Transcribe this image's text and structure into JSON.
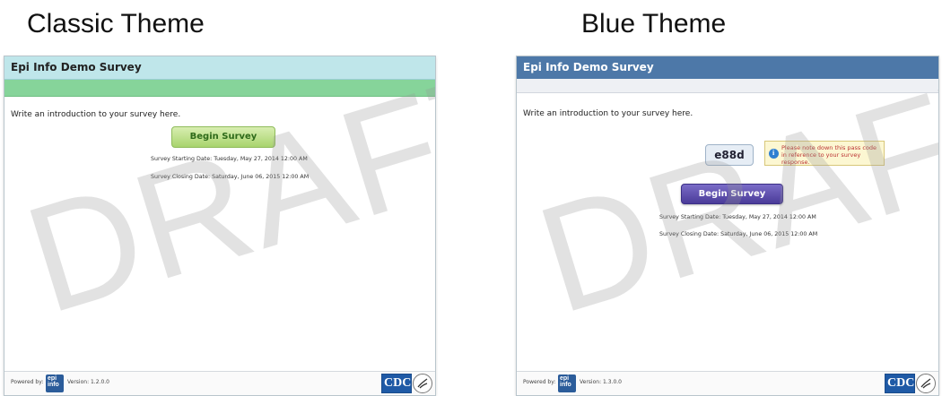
{
  "headings": {
    "classic": "Classic Theme",
    "blue": "Blue Theme"
  },
  "classic": {
    "title": "Epi Info Demo Survey",
    "intro": "Write an introduction to your survey here.",
    "begin_label": "Begin Survey",
    "start_date": "Survey Starting Date: Tuesday, May 27, 2014 12:00 AM",
    "close_date": "Survey Closing Date: Saturday, June 06, 2015 12:00 AM",
    "powered_by": "Powered by:",
    "version": "Version: 1.2.0.0"
  },
  "blue": {
    "title": "Epi Info Demo Survey",
    "intro": "Write an introduction to your survey here.",
    "pass_code": "e88d",
    "pass_note": "Please note down this pass code in reference to your survey response.",
    "begin_label": "Begin Survey",
    "start_date": "Survey Starting Date: Tuesday, May 27, 2014 12:00 AM",
    "close_date": "Survey Closing Date: Saturday, June 06, 2015 12:00 AM",
    "powered_by": "Powered by:",
    "version": "Version: 1.3.0.0"
  },
  "logos": {
    "epi": "epi info",
    "cdc": "CDC"
  },
  "watermark": "DRAFT",
  "colors": {
    "classic_title_bg": "#bfe6ea",
    "classic_band": "#86d49a",
    "blue_title_bg": "#4d78a8",
    "blue_button": "#4a3b99",
    "classic_button": "#a8d46d"
  }
}
